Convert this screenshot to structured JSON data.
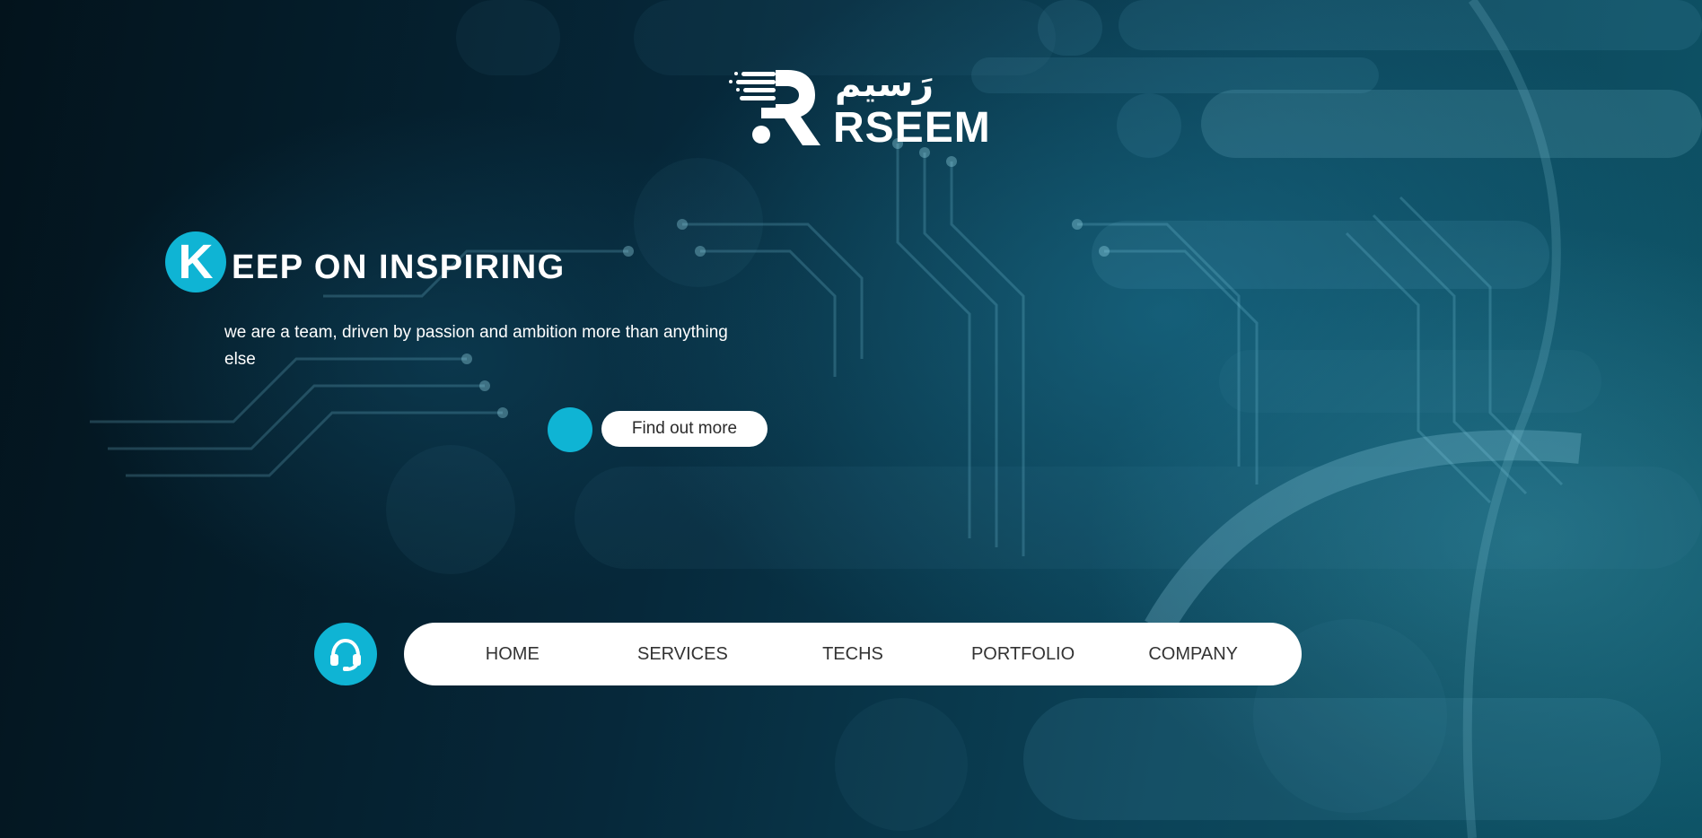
{
  "brand": {
    "arabic_name": "رَسيم",
    "latin_name": "RSEEM"
  },
  "hero": {
    "headline_initial": "K",
    "headline_rest": "EEP ON INSPIRING",
    "tagline": "we are a team, driven by passion and ambition more than anything else",
    "cta_label": "Find out more"
  },
  "nav": {
    "items": [
      {
        "label": "HOME"
      },
      {
        "label": "SERVICES"
      },
      {
        "label": "TECHS"
      },
      {
        "label": "PORTFOLIO"
      },
      {
        "label": "COMPANY"
      }
    ]
  },
  "icons": {
    "support": "headset-icon",
    "logo": "rseem-logo-mark"
  },
  "colors": {
    "accent": "#0fb4d4",
    "text_light": "#ffffff",
    "nav_text": "#333333",
    "background_dark": "#03131c",
    "background_teal": "#0e5467"
  }
}
